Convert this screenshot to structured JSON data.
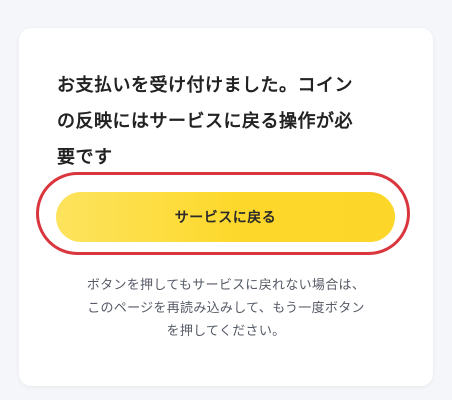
{
  "card": {
    "message_lines": [
      "お支払いを受け付けました。コイン",
      "の反映にはサービスに戻る操作が必",
      "要です"
    ],
    "return_button_label": "サービスに戻る",
    "hint_lines": [
      "ボタンを押してもサービスに戻れない場合は、",
      "このページを再読み込みして、もう一度ボタン",
      "を押してください。"
    ]
  },
  "colors": {
    "button_yellow": "#fdd82a",
    "highlight_red": "#d9363e",
    "page_background": "#f4f6f9",
    "card_background": "#ffffff"
  }
}
